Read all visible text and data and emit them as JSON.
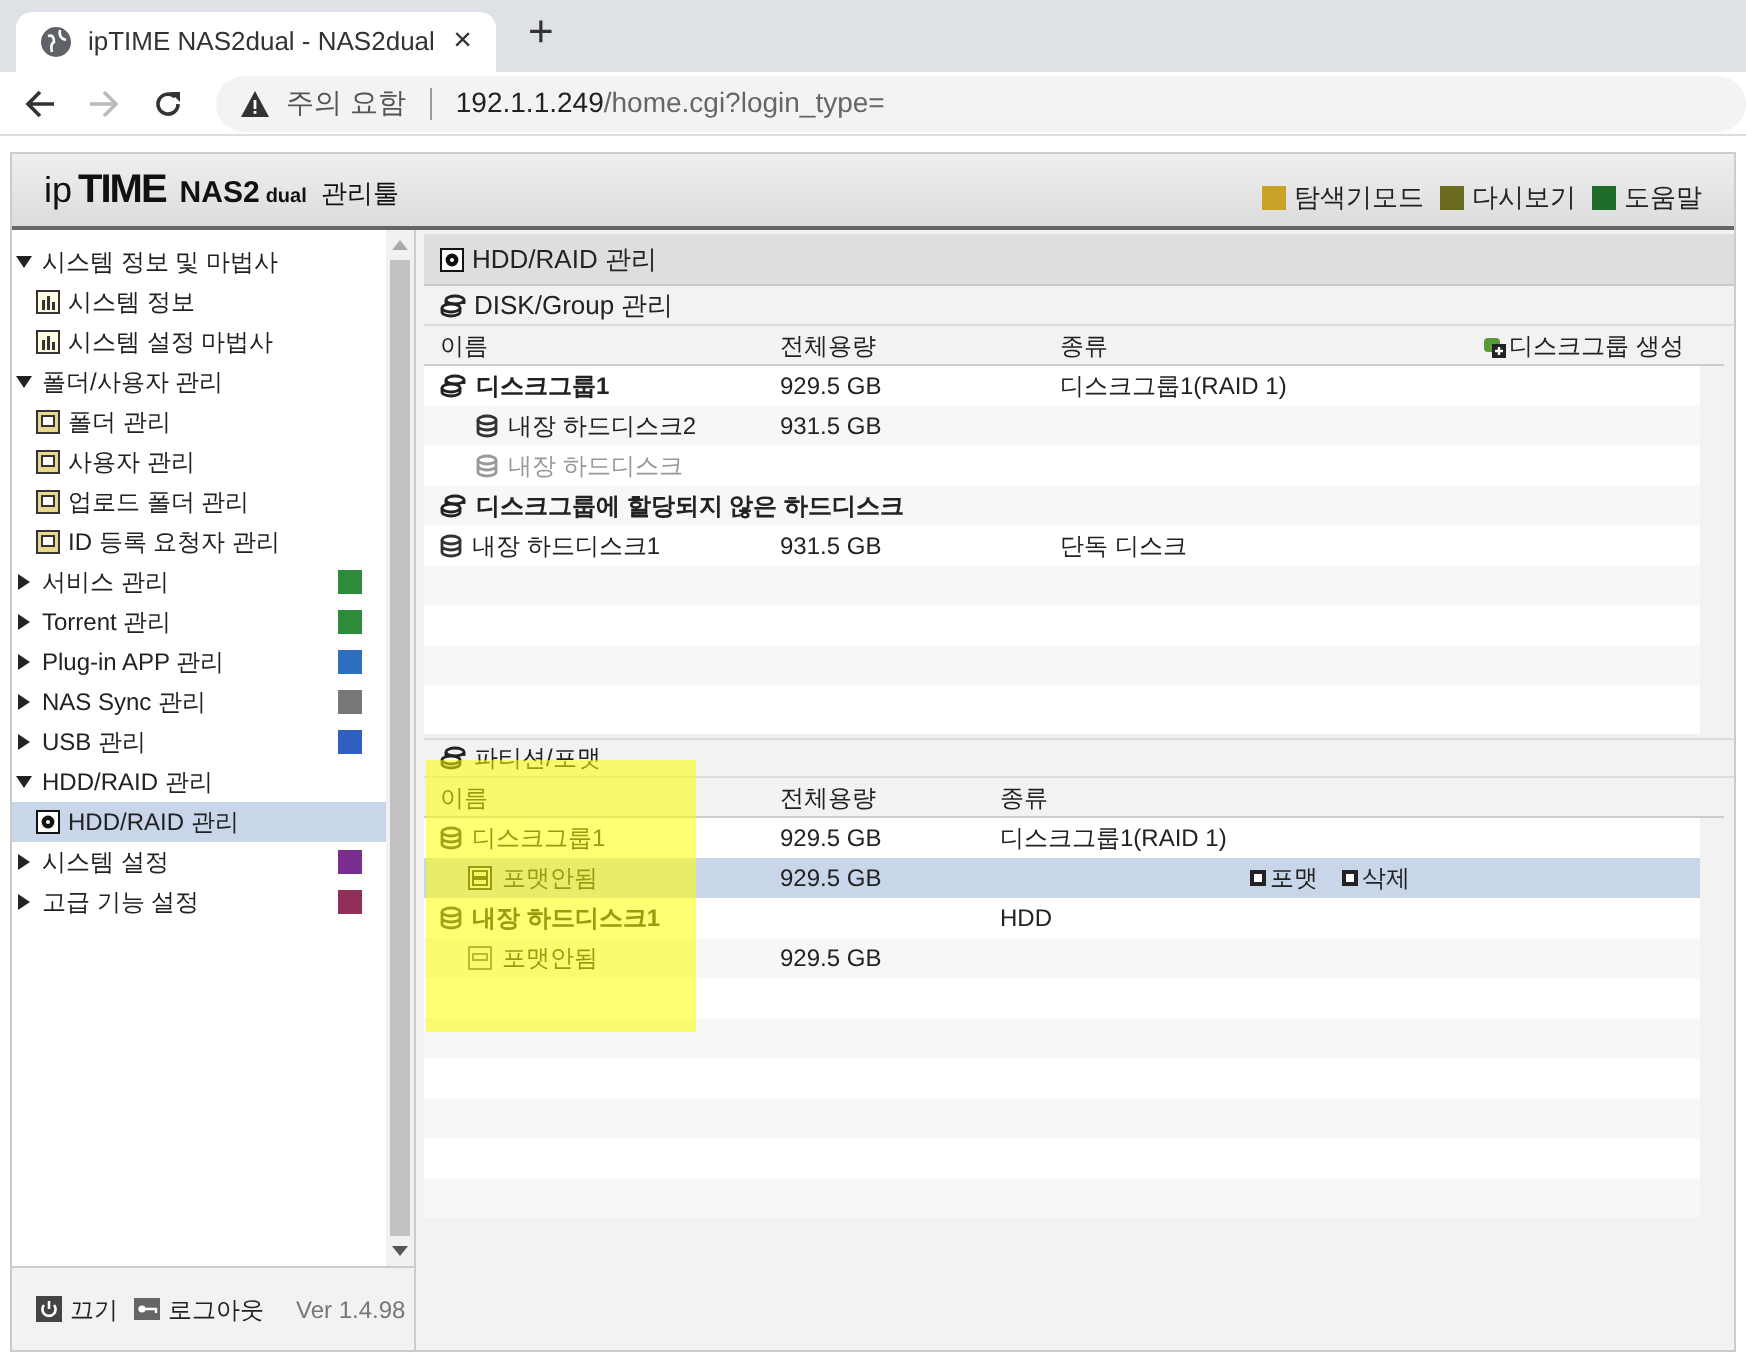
{
  "browser": {
    "tab_title": "ipTIME NAS2dual - NAS2dual",
    "new_tab": "+",
    "close": "×",
    "security": "주의 요함",
    "url_host": "192.1.1.249",
    "url_path": "/home.cgi?login_type="
  },
  "header": {
    "logo_ip": "ip",
    "logo_time": "TIME",
    "logo_nas": "NAS2",
    "logo_dual": "dual",
    "logo_tool": "관리툴",
    "links": [
      {
        "label": "탐색기모드",
        "color": "#c9a227"
      },
      {
        "label": "다시보기",
        "color": "#6b6b1f"
      },
      {
        "label": "도움말",
        "color": "#1f6b2a"
      }
    ]
  },
  "sidebar": {
    "items": [
      {
        "label": "시스템 정보 및 마법사",
        "expanded": true,
        "children": [
          {
            "label": "시스템 정보",
            "kind": "chart",
            "selected": false
          },
          {
            "label": "시스템 설정 마법사",
            "kind": "chart",
            "selected": false
          }
        ]
      },
      {
        "label": "폴더/사용자 관리",
        "expanded": true,
        "children": [
          {
            "label": "폴더 관리",
            "kind": "picture",
            "selected": false
          },
          {
            "label": "사용자 관리",
            "kind": "picture",
            "selected": false
          },
          {
            "label": "업로드 폴더 관리",
            "kind": "picture",
            "selected": false
          },
          {
            "label": "ID 등록 요청자 관리",
            "kind": "picture",
            "selected": false
          }
        ]
      },
      {
        "label": "서비스 관리",
        "expanded": false,
        "color": "#2e8b3a"
      },
      {
        "label": "Torrent 관리",
        "expanded": false,
        "color": "#2e8b3a"
      },
      {
        "label": "Plug-in APP 관리",
        "expanded": false,
        "color": "#2f6fbf"
      },
      {
        "label": "NAS Sync 관리",
        "expanded": false,
        "color": "#777777"
      },
      {
        "label": "USB 관리",
        "expanded": false,
        "color": "#2f5fbf"
      },
      {
        "label": "HDD/RAID 관리",
        "expanded": true,
        "children": [
          {
            "label": "HDD/RAID 관리",
            "kind": "disk",
            "selected": true
          }
        ]
      },
      {
        "label": "시스템 설정",
        "expanded": false,
        "color": "#7a2f8f"
      },
      {
        "label": "고급 기능 설정",
        "expanded": false,
        "color": "#8f2f5a"
      }
    ]
  },
  "footer": {
    "power": "끄기",
    "logout": "로그아웃",
    "version": "Ver 1.4.98"
  },
  "main": {
    "title": "HDD/RAID 관리",
    "disk_section": {
      "title": "DISK/Group 관리",
      "columns": [
        "이름",
        "전체용량",
        "종류"
      ],
      "create_action": "디스크그룹 생성",
      "rows": [
        {
          "name": "디스크그룹1",
          "kind": "group",
          "size": "929.5 GB",
          "type": "디스크그룹1(RAID 1)",
          "children": [
            {
              "name": "내장 하드디스크2",
              "kind": "disk",
              "size": "931.5 GB",
              "disabled": false
            },
            {
              "name": "내장 하드디스크",
              "kind": "disk",
              "disabled": true
            }
          ]
        },
        {
          "name": "디스크그룹에 할당되지 않은 하드디스크",
          "kind": "group",
          "children": []
        },
        {
          "name": "내장 하드디스크1",
          "kind": "disk",
          "size": "931.5 GB",
          "type": "단독 디스크",
          "disabled": false
        }
      ]
    },
    "partition_section": {
      "title": "파티션/포맷",
      "columns": [
        "이름",
        "전체용량",
        "종류"
      ],
      "rows": [
        {
          "name": "디스크그룹1",
          "size": "929.5 GB",
          "type": "디스크그룹1(RAID 1)",
          "selected": false,
          "children": [
            {
              "name": "포맷안됨",
              "size": "929.5 GB",
              "selected": true,
              "kind": "volume",
              "actions": [
                "포맷",
                "삭제"
              ]
            }
          ]
        },
        {
          "name": "내장 하드디스크1",
          "type": "HDD",
          "selected": false,
          "children": [
            {
              "name": "포맷안됨",
              "size": "929.5 GB",
              "selected": false,
              "kind": "partition"
            }
          ]
        }
      ]
    }
  }
}
